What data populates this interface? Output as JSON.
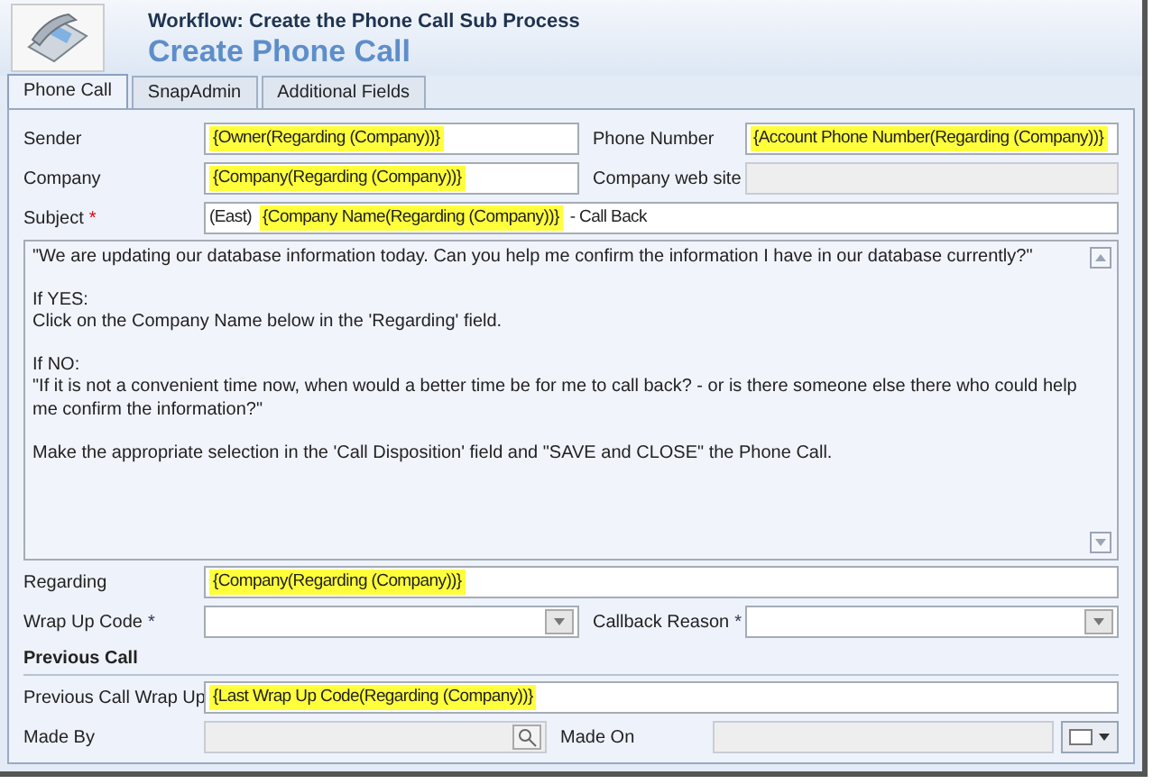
{
  "header": {
    "subtitle": "Workflow: Create the Phone Call Sub Process",
    "title": "Create Phone Call"
  },
  "tabs": [
    {
      "label": "Phone Call",
      "selected": true
    },
    {
      "label": "SnapAdmin",
      "selected": false
    },
    {
      "label": "Additional Fields",
      "selected": false
    }
  ],
  "rows": [
    {
      "kind": "pair",
      "fields": [
        {
          "label": "Sender",
          "kind": "text",
          "disabled": false,
          "parts": [
            {
              "kind": "token",
              "text": "{Owner(Regarding (Company))}"
            }
          ]
        },
        {
          "label": "Phone Number",
          "kind": "text",
          "disabled": false,
          "parts": [
            {
              "kind": "token",
              "text": "{Account Phone Number(Regarding (Company))}"
            }
          ]
        }
      ]
    },
    {
      "kind": "pair",
      "fields": [
        {
          "label": "Company",
          "kind": "text",
          "disabled": false,
          "parts": [
            {
              "kind": "token",
              "text": "{Company(Regarding (Company))}"
            }
          ]
        },
        {
          "label": "Company web site",
          "kind": "text",
          "disabled": true
        }
      ]
    },
    {
      "kind": "wide",
      "fields": [
        {
          "label": "Subject",
          "kind": "text",
          "disabled": false,
          "required_mark": "*",
          "required": true,
          "parts": [
            {
              "kind": "text",
              "text": "(East)"
            },
            {
              "kind": "token",
              "text": "{Company Name(Regarding (Company))}"
            },
            {
              "kind": "text",
              "text": "- Call Back"
            }
          ]
        }
      ]
    },
    {
      "kind": "notes",
      "paragraphs": [
        [
          "\"We are updating our database information today.  Can you help me confirm the information I have in our database currently?\""
        ],
        [
          "If YES:",
          "Click on the Company Name below in the 'Regarding' field."
        ],
        [
          "If NO:",
          "\"If it is not a convenient time now, when would a better time be for me to call back? - or is there someone else there who could help me confirm the information?\""
        ],
        [
          "Make the appropriate selection in the 'Call Disposition' field and \"SAVE and CLOSE\" the Phone Call."
        ]
      ]
    },
    {
      "kind": "wide",
      "fields": [
        {
          "label": "Regarding",
          "kind": "text",
          "disabled": false,
          "parts": [
            {
              "kind": "token",
              "text": "{Company(Regarding (Company))}"
            }
          ]
        }
      ]
    },
    {
      "kind": "pair",
      "fields": [
        {
          "label": "Wrap Up Code",
          "kind": "select",
          "disabled": false,
          "required_mark": "*",
          "required": false
        },
        {
          "label": "Callback Reason",
          "kind": "select",
          "disabled": false,
          "required_mark": "*",
          "required": false
        }
      ]
    },
    {
      "kind": "heading",
      "title": "Previous Call"
    },
    {
      "kind": "wide",
      "fields": [
        {
          "label": "Previous Call Wrap Up",
          "kind": "text",
          "disabled": false,
          "parts": [
            {
              "kind": "token",
              "text": "{Last Wrap Up Code(Regarding (Company))}"
            }
          ]
        }
      ]
    },
    {
      "kind": "pair",
      "fields": [
        {
          "label": "Made By",
          "kind": "lookup",
          "disabled": true
        },
        {
          "label": "Made On",
          "kind": "date",
          "disabled": true
        }
      ]
    }
  ]
}
